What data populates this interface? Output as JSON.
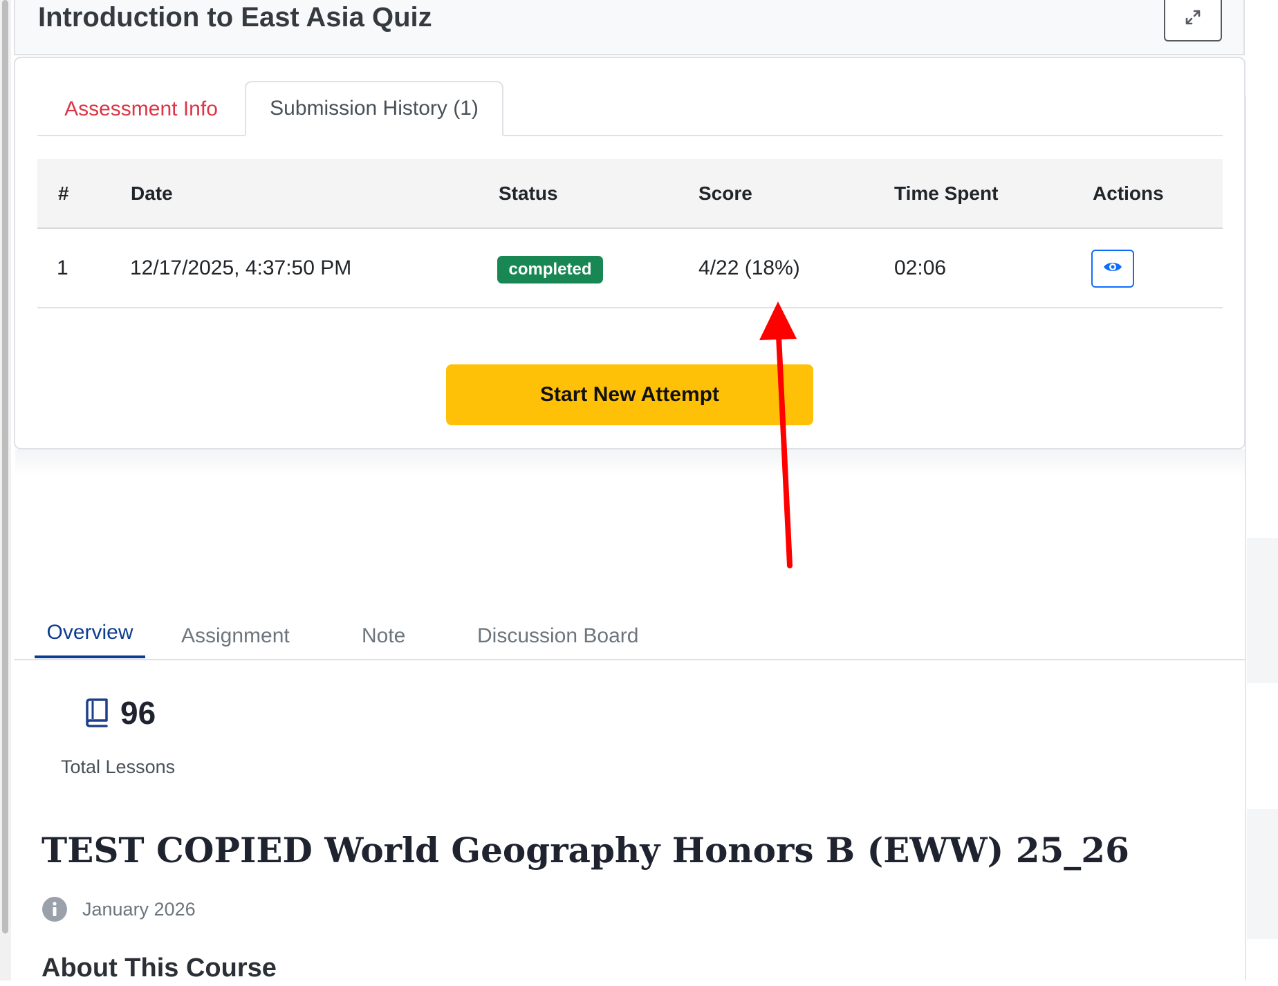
{
  "header": {
    "title": "Introduction to East Asia Quiz",
    "expand_icon": "expand-arrows-icon"
  },
  "tabs": [
    {
      "label": "Assessment Info",
      "active": false
    },
    {
      "label": "Submission History (1)",
      "active": true
    }
  ],
  "submission_table": {
    "columns": [
      "#",
      "Date",
      "Status",
      "Score",
      "Time Spent",
      "Actions"
    ],
    "rows": [
      {
        "number": "1",
        "date": "12/17/2025, 4:37:50 PM",
        "status": "completed",
        "score": "4/22 (18%)",
        "time_spent": "02:06",
        "action_icon": "eye-icon"
      }
    ]
  },
  "start_button_label": "Start New Attempt",
  "course_tabs": [
    {
      "label": "Overview",
      "active": true
    },
    {
      "label": "Assignment",
      "active": false
    },
    {
      "label": "Note",
      "active": false
    },
    {
      "label": "Discussion Board",
      "active": false
    }
  ],
  "stats": {
    "total_lessons_value": "96",
    "total_lessons_label": "Total Lessons",
    "icon": "book-icon"
  },
  "course": {
    "title": "TEST COPIED World Geography Honors B (EWW) 25_26",
    "date": "January 2026",
    "date_icon": "info-icon",
    "about_heading": "About This Course"
  },
  "colors": {
    "accent_red": "#dc3545",
    "status_green": "#198754",
    "start_button_yellow": "#ffc107",
    "primary_blue": "#0d6efd",
    "overview_blue": "#0d3d91",
    "annotation_arrow": "#ff0000"
  }
}
